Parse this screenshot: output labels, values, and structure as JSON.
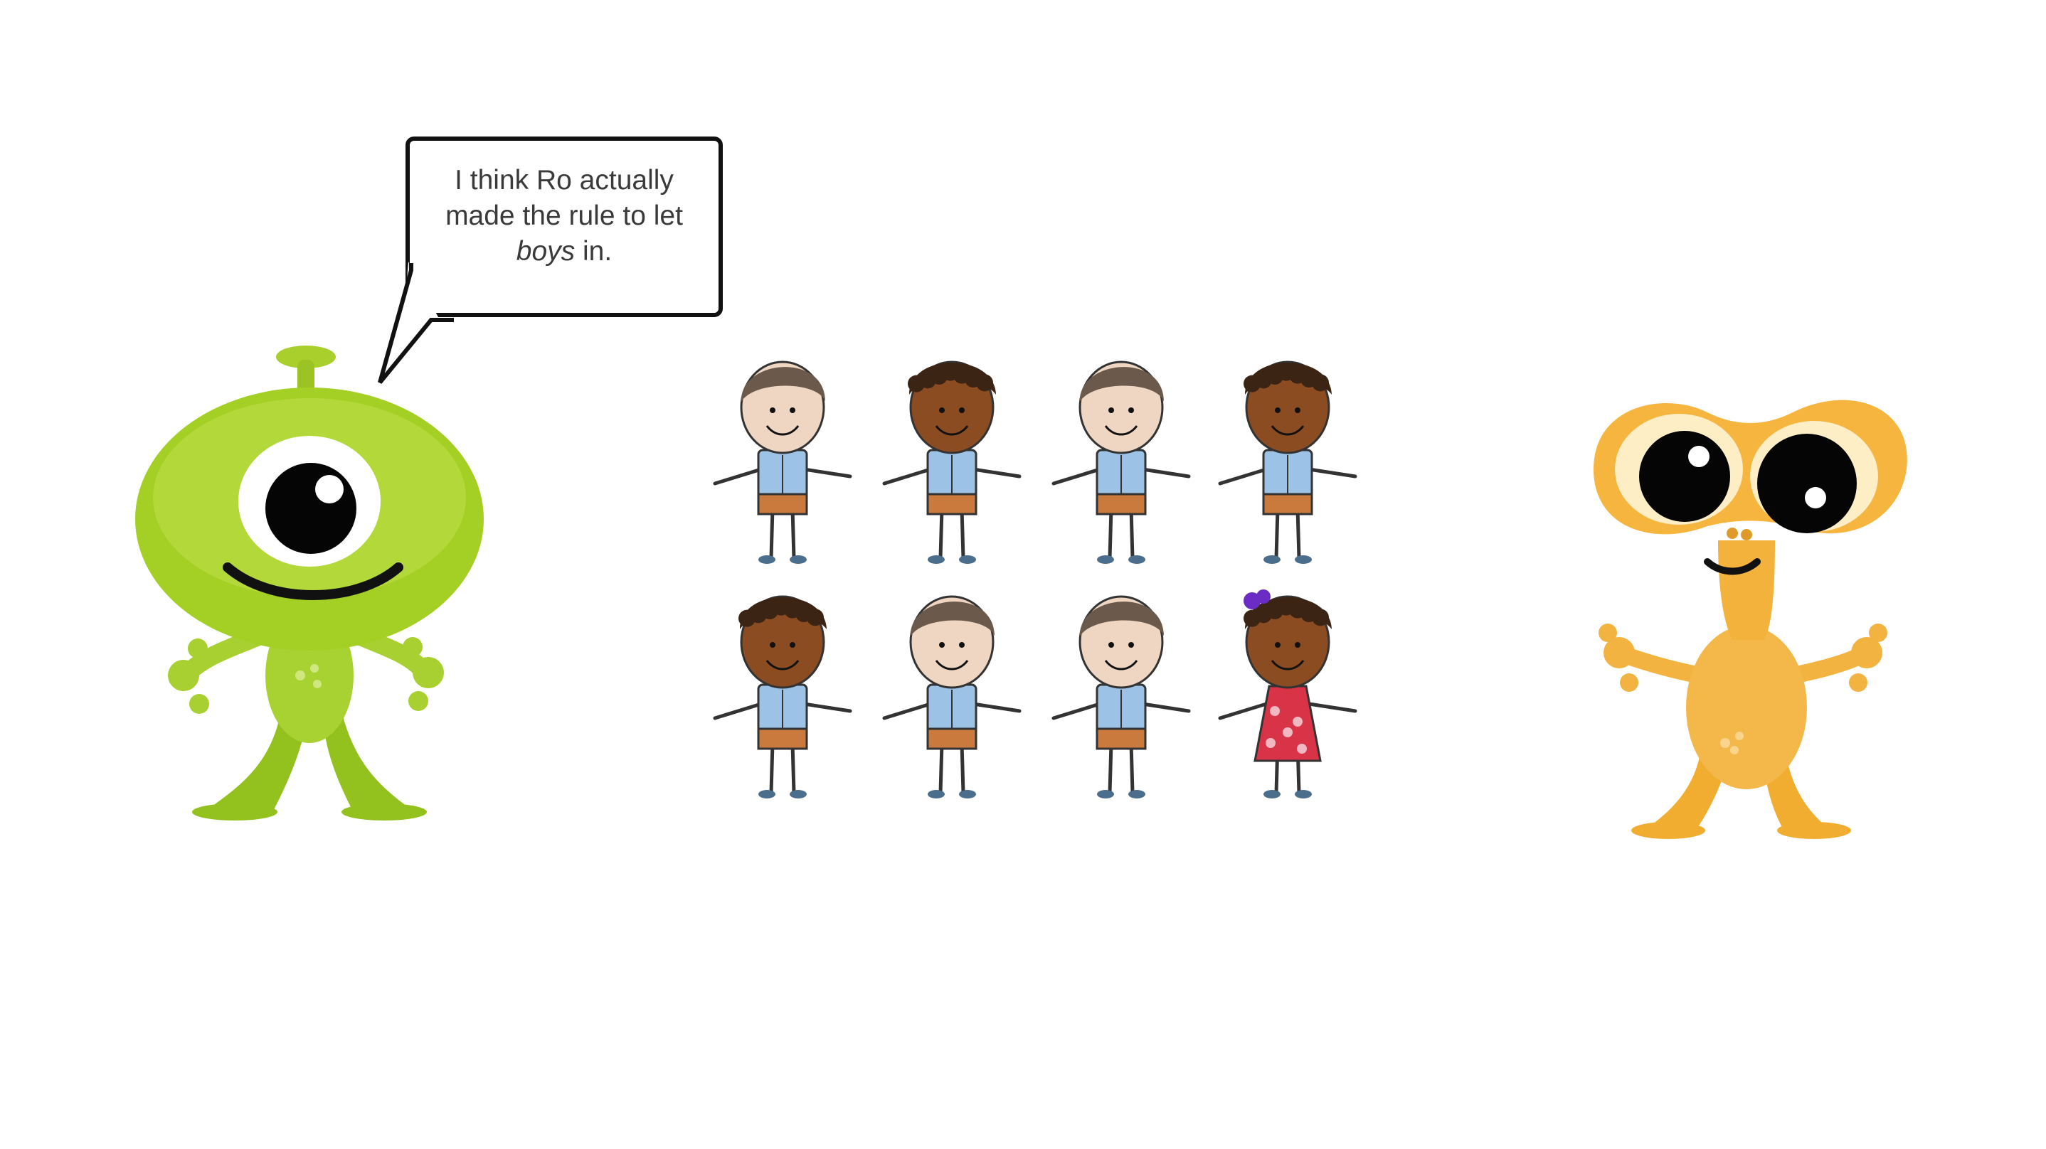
{
  "speech_bubble": {
    "line1": "I think Ro actually",
    "line2": "made the rule to let",
    "line3_emphasis": "boys",
    "line3_rest": " in."
  },
  "characters": {
    "left_alien": {
      "icon": "green-one-eyed-alien-icon",
      "color": "#a6d12a"
    },
    "right_alien": {
      "icon": "orange-two-eyed-alien-icon",
      "color": "#f3b23c"
    }
  },
  "children_grid": {
    "rows": [
      [
        "boy-light",
        "boy-dark",
        "boy-light",
        "boy-dark"
      ],
      [
        "boy-dark",
        "boy-light",
        "boy-light",
        "girl-dark"
      ]
    ]
  },
  "colors": {
    "skin_light": "#efd6c2",
    "skin_dark": "#8b4c22",
    "shirt": "#9cc3e6",
    "shorts": "#c97a3c",
    "dress": "#d93348"
  }
}
